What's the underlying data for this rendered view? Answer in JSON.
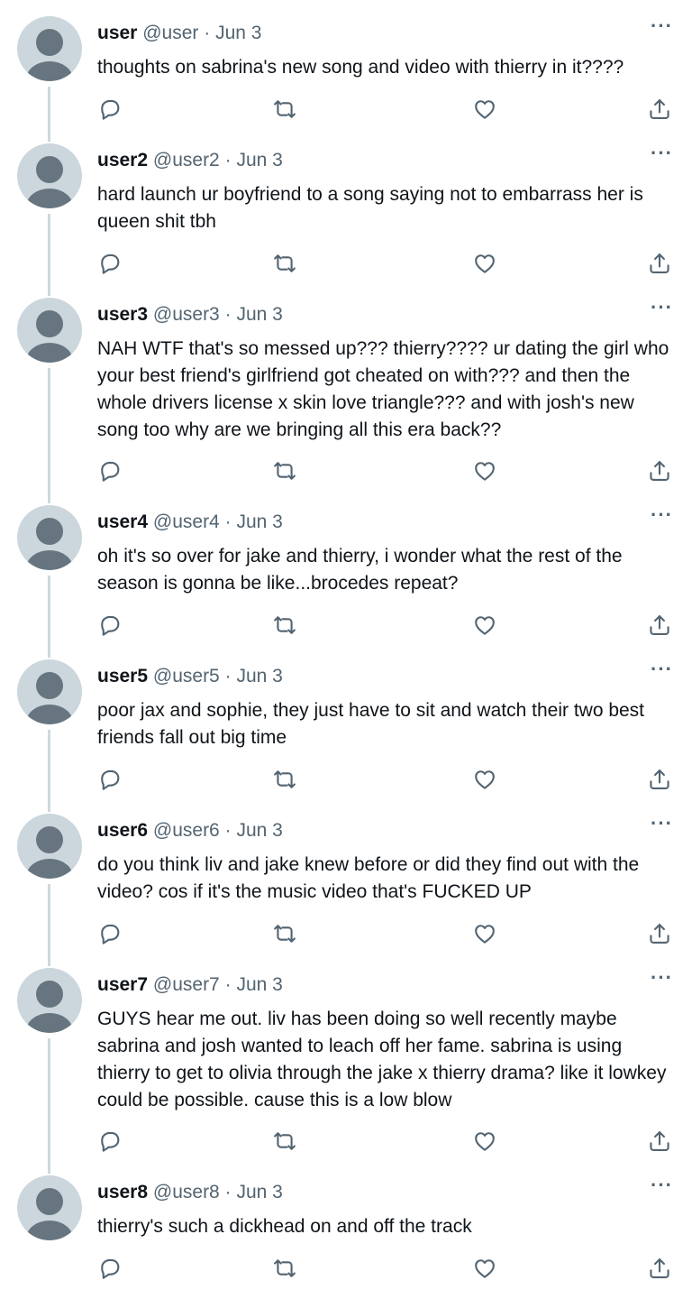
{
  "more_label": "···",
  "tweets": [
    {
      "name": "user",
      "handle": "@user",
      "sep": "·",
      "date": "Jun 3",
      "text": "thoughts on sabrina's new song and video with thierry in it????"
    },
    {
      "name": "user2",
      "handle": "@user2",
      "sep": "·",
      "date": "Jun 3",
      "text": "hard launch ur boyfriend to a song saying not to embarrass her is queen shit tbh"
    },
    {
      "name": "user3",
      "handle": "@user3",
      "sep": "·",
      "date": "Jun 3",
      "text": "NAH WTF that's so messed up??? thierry???? ur dating the girl who your best friend's girlfriend got cheated on with??? and then the whole drivers license x skin love triangle??? and with josh's new song too why are we bringing all this era back??"
    },
    {
      "name": "user4",
      "handle": "@user4",
      "sep": "·",
      "date": "Jun 3",
      "text": "oh it's so over for jake and thierry, i wonder what the rest of the season is gonna be like...brocedes repeat?"
    },
    {
      "name": "user5",
      "handle": "@user5",
      "sep": "·",
      "date": "Jun 3",
      "text": "poor jax and sophie, they just have to sit and watch their two best friends fall out big time"
    },
    {
      "name": "user6",
      "handle": "@user6",
      "sep": "·",
      "date": "Jun 3",
      "text": "do you think liv and jake knew before or did they find out with the video? cos if it's the music video that's FUCKED UP"
    },
    {
      "name": "user7",
      "handle": "@user7",
      "sep": "·",
      "date": "Jun 3",
      "text": "GUYS hear me out. liv has been doing so well recently maybe sabrina and josh wanted to leach off her fame. sabrina is using thierry to get to olivia through the jake x thierry drama? like it lowkey could be possible. cause this is a low blow"
    },
    {
      "name": "user8",
      "handle": "@user8",
      "sep": "·",
      "date": "Jun 3",
      "text": "thierry's such a dickhead on and off the track"
    }
  ],
  "actions": [
    {
      "name": "reply-icon",
      "icon": "reply"
    },
    {
      "name": "retweet-icon",
      "icon": "retweet"
    },
    {
      "name": "like-icon",
      "icon": "heart"
    },
    {
      "name": "share-icon",
      "icon": "share"
    }
  ],
  "colors": {
    "text": "#0f1419",
    "secondary": "#536471",
    "thread_line": "#cfd9de",
    "avatar_bg": "#ccd6dd",
    "avatar_fg": "#66757f"
  }
}
